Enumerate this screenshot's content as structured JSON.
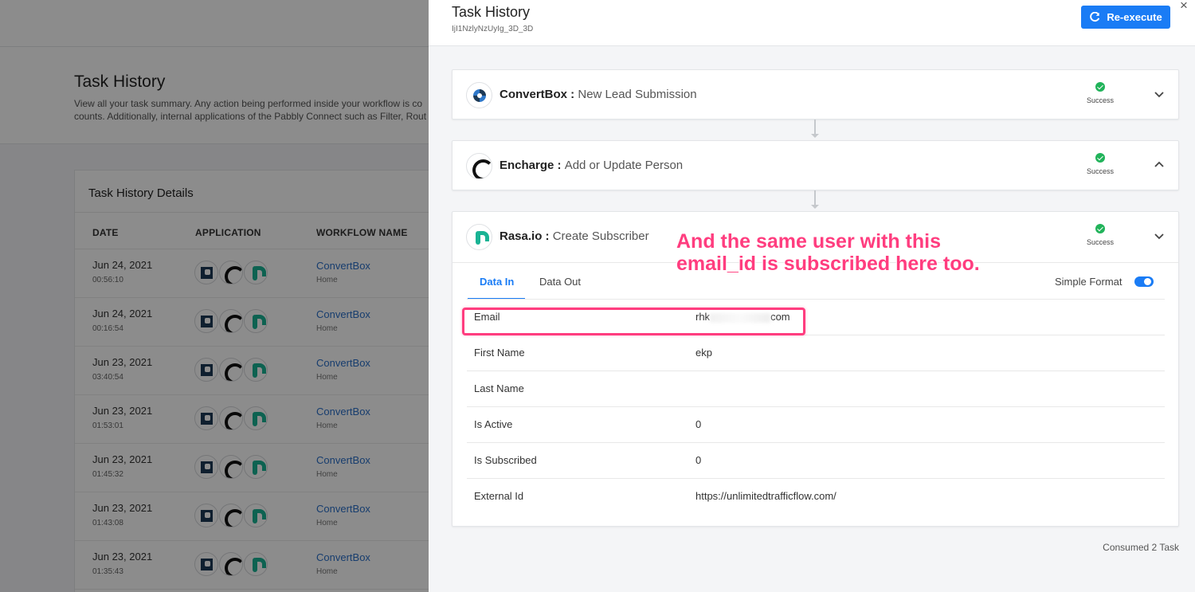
{
  "background": {
    "title": "Task History",
    "description_line1": "View all your task summary. Any action being performed inside your workflow is co",
    "description_line2": "counts. Additionally, internal applications of the Pabbly Connect such as Filter, Rout",
    "card_title": "Task History Details",
    "columns": [
      "DATE",
      "APPLICATION",
      "WORKFLOW NAME"
    ],
    "rows": [
      {
        "date": "Jun 24, 2021",
        "time": "00:56:10",
        "workflow": "ConvertBox",
        "folder": "Home"
      },
      {
        "date": "Jun 24, 2021",
        "time": "00:16:54",
        "workflow": "ConvertBox",
        "folder": "Home"
      },
      {
        "date": "Jun 23, 2021",
        "time": "03:40:54",
        "workflow": "ConvertBox",
        "folder": "Home"
      },
      {
        "date": "Jun 23, 2021",
        "time": "01:53:01",
        "workflow": "ConvertBox",
        "folder": "Home"
      },
      {
        "date": "Jun 23, 2021",
        "time": "01:45:32",
        "workflow": "ConvertBox",
        "folder": "Home"
      },
      {
        "date": "Jun 23, 2021",
        "time": "01:43:08",
        "workflow": "ConvertBox",
        "folder": "Home"
      },
      {
        "date": "Jun 23, 2021",
        "time": "01:35:43",
        "workflow": "ConvertBox",
        "folder": "Home"
      }
    ]
  },
  "drawer": {
    "title": "Task History",
    "task_id": "IjI1NzlyNzUyIg_3D_3D",
    "reexecute_label": "Re-execute",
    "close_symbol": "×",
    "steps": [
      {
        "app": "ConvertBox :",
        "action": "New Lead Submission",
        "status": "Success"
      },
      {
        "app": "Encharge :",
        "action": "Add or Update Person",
        "status": "Success"
      },
      {
        "app": "Rasa.io :",
        "action": "Create Subscriber",
        "status": "Success"
      }
    ],
    "tabs": [
      "Data In",
      "Data Out"
    ],
    "simple_format_label": "Simple Format",
    "fields": [
      {
        "key": "Email",
        "val_prefix": "rhk",
        "val_suffix": "com"
      },
      {
        "key": "First Name",
        "value": "ekp"
      },
      {
        "key": "Last Name",
        "value": ""
      },
      {
        "key": "Is Active",
        "value": "0"
      },
      {
        "key": "Is Subscribed",
        "value": "0"
      },
      {
        "key": "External Id",
        "value": "https://unlimitedtrafficflow.com/"
      }
    ],
    "consumed": "Consumed 2 Task"
  },
  "annotation": {
    "line1": "And the same user with this",
    "line2": "email_id is subscribed here too.",
    "color": "#ff3d7f"
  },
  "colors": {
    "primary": "#1a7cf5",
    "success": "#21b35a",
    "rasa": "#19b394"
  }
}
